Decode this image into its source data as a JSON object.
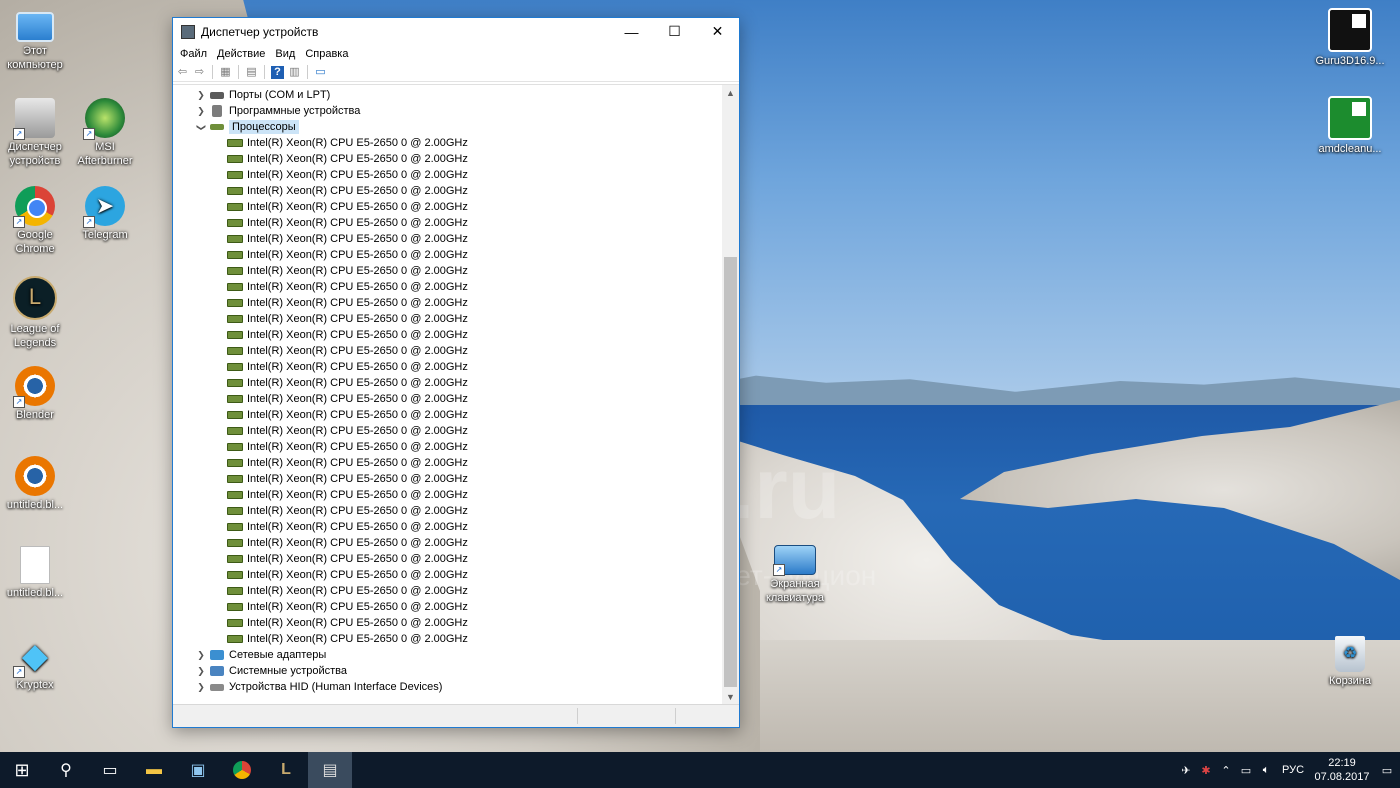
{
  "desktop": {
    "icons_left": [
      {
        "label": "Этот компьютер",
        "icon": "computer-icon"
      },
      {
        "label": "Диспетчер устройств",
        "icon": "device-manager-icon"
      },
      {
        "label": "MSI Afterburner",
        "icon": "msi-afterburner-icon"
      },
      {
        "label": "Google Chrome",
        "icon": "chrome-icon"
      },
      {
        "label": "Telegram",
        "icon": "telegram-icon"
      },
      {
        "label": "League of Legends",
        "icon": "league-of-legends-icon"
      },
      {
        "label": "Blender",
        "icon": "blender-icon"
      },
      {
        "label": "untitled.bl...",
        "icon": "blender-file-icon"
      },
      {
        "label": "untitled.bl...",
        "icon": "file-icon"
      },
      {
        "label": "Kryptex",
        "icon": "kryptex-icon"
      }
    ],
    "icons_right": [
      {
        "label": "Guru3D16.9...",
        "icon": "amd-icon"
      },
      {
        "label": "amdcleanu...",
        "icon": "amd-cleanup-icon"
      },
      {
        "label": "Экранная клавиатура",
        "icon": "on-screen-keyboard-icon"
      },
      {
        "label": "Корзина",
        "icon": "recycle-bin-icon"
      }
    ],
    "watermark": {
      "line1": "au.ru",
      "line2": "интернет-аукцион"
    }
  },
  "window": {
    "title": "Диспетчер устройств",
    "controls": {
      "minimize": "—",
      "maximize": "☐",
      "close": "✕"
    },
    "menu": [
      "Файл",
      "Действие",
      "Вид",
      "Справка"
    ],
    "tree": {
      "before": [
        {
          "label": "Порты (COM и LPT)",
          "expanded": false
        },
        {
          "label": "Программные устройства",
          "expanded": false
        }
      ],
      "processors": {
        "label": "Процессоры",
        "expanded": true,
        "items": [
          "Intel(R) Xeon(R) CPU E5-2650 0 @ 2.00GHz",
          "Intel(R) Xeon(R) CPU E5-2650 0 @ 2.00GHz",
          "Intel(R) Xeon(R) CPU E5-2650 0 @ 2.00GHz",
          "Intel(R) Xeon(R) CPU E5-2650 0 @ 2.00GHz",
          "Intel(R) Xeon(R) CPU E5-2650 0 @ 2.00GHz",
          "Intel(R) Xeon(R) CPU E5-2650 0 @ 2.00GHz",
          "Intel(R) Xeon(R) CPU E5-2650 0 @ 2.00GHz",
          "Intel(R) Xeon(R) CPU E5-2650 0 @ 2.00GHz",
          "Intel(R) Xeon(R) CPU E5-2650 0 @ 2.00GHz",
          "Intel(R) Xeon(R) CPU E5-2650 0 @ 2.00GHz",
          "Intel(R) Xeon(R) CPU E5-2650 0 @ 2.00GHz",
          "Intel(R) Xeon(R) CPU E5-2650 0 @ 2.00GHz",
          "Intel(R) Xeon(R) CPU E5-2650 0 @ 2.00GHz",
          "Intel(R) Xeon(R) CPU E5-2650 0 @ 2.00GHz",
          "Intel(R) Xeon(R) CPU E5-2650 0 @ 2.00GHz",
          "Intel(R) Xeon(R) CPU E5-2650 0 @ 2.00GHz",
          "Intel(R) Xeon(R) CPU E5-2650 0 @ 2.00GHz",
          "Intel(R) Xeon(R) CPU E5-2650 0 @ 2.00GHz",
          "Intel(R) Xeon(R) CPU E5-2650 0 @ 2.00GHz",
          "Intel(R) Xeon(R) CPU E5-2650 0 @ 2.00GHz",
          "Intel(R) Xeon(R) CPU E5-2650 0 @ 2.00GHz",
          "Intel(R) Xeon(R) CPU E5-2650 0 @ 2.00GHz",
          "Intel(R) Xeon(R) CPU E5-2650 0 @ 2.00GHz",
          "Intel(R) Xeon(R) CPU E5-2650 0 @ 2.00GHz",
          "Intel(R) Xeon(R) CPU E5-2650 0 @ 2.00GHz",
          "Intel(R) Xeon(R) CPU E5-2650 0 @ 2.00GHz",
          "Intel(R) Xeon(R) CPU E5-2650 0 @ 2.00GHz",
          "Intel(R) Xeon(R) CPU E5-2650 0 @ 2.00GHz",
          "Intel(R) Xeon(R) CPU E5-2650 0 @ 2.00GHz",
          "Intel(R) Xeon(R) CPU E5-2650 0 @ 2.00GHz",
          "Intel(R) Xeon(R) CPU E5-2650 0 @ 2.00GHz",
          "Intel(R) Xeon(R) CPU E5-2650 0 @ 2.00GHz"
        ]
      },
      "after": [
        {
          "label": "Сетевые адаптеры",
          "expanded": false
        },
        {
          "label": "Системные устройства",
          "expanded": false
        },
        {
          "label": "Устройства HID (Human Interface Devices)",
          "expanded": false
        }
      ]
    }
  },
  "taskbar": {
    "apps": [
      "start-icon",
      "search-icon",
      "task-view-icon",
      "file-explorer-icon",
      "network-app-icon",
      "chrome-icon",
      "league-of-legends-icon",
      "device-manager-icon"
    ],
    "tray": {
      "language": "РУС",
      "time": "22:19",
      "date": "07.08.2017"
    }
  },
  "colors": {
    "accent": "#1f7ad1",
    "selection": "#cce4f7",
    "taskbar": "#0d1a2a"
  }
}
